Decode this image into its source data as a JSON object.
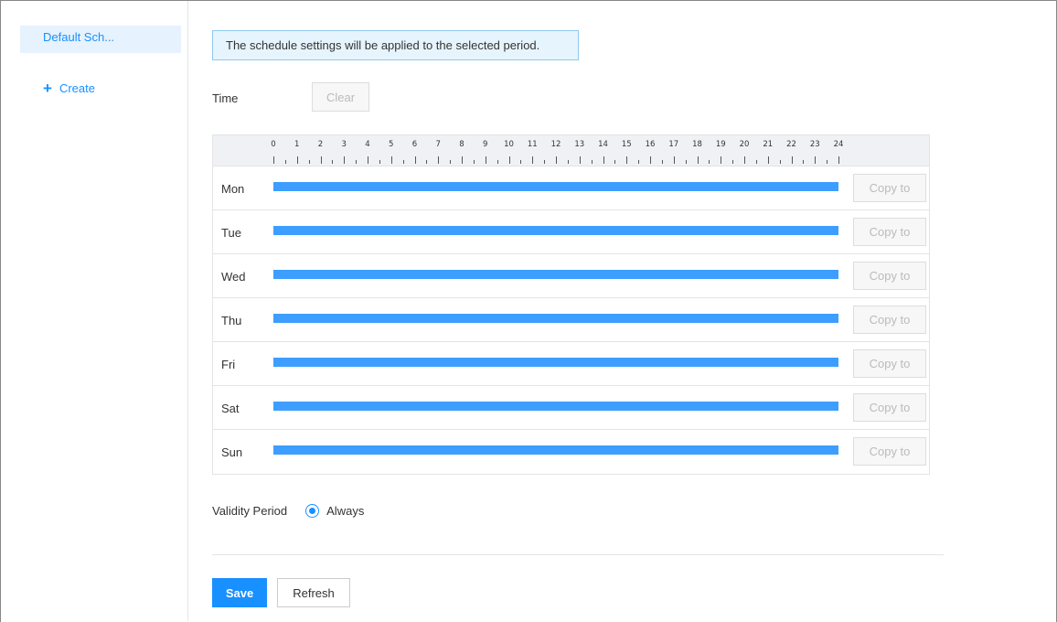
{
  "sidebar": {
    "selected_item": "Default Sch...",
    "create_label": "Create"
  },
  "notice": "The schedule settings will be applied to the selected period.",
  "time": {
    "label": "Time",
    "clear_label": "Clear"
  },
  "ruler": {
    "hours": [
      "0",
      "1",
      "2",
      "3",
      "4",
      "5",
      "6",
      "7",
      "8",
      "9",
      "10",
      "11",
      "12",
      "13",
      "14",
      "15",
      "16",
      "17",
      "18",
      "19",
      "20",
      "21",
      "22",
      "23",
      "24"
    ]
  },
  "schedule": {
    "copy_label": "Copy to",
    "days": [
      {
        "day": "Mon",
        "start": 0,
        "end": 24
      },
      {
        "day": "Tue",
        "start": 0,
        "end": 24
      },
      {
        "day": "Wed",
        "start": 0,
        "end": 24
      },
      {
        "day": "Thu",
        "start": 0,
        "end": 24
      },
      {
        "day": "Fri",
        "start": 0,
        "end": 24
      },
      {
        "day": "Sat",
        "start": 0,
        "end": 24
      },
      {
        "day": "Sun",
        "start": 0,
        "end": 24
      }
    ]
  },
  "validity": {
    "label": "Validity Period",
    "option": "Always"
  },
  "actions": {
    "save_label": "Save",
    "refresh_label": "Refresh"
  },
  "colors": {
    "accent": "#1890ff",
    "bar": "#3d9eff"
  }
}
